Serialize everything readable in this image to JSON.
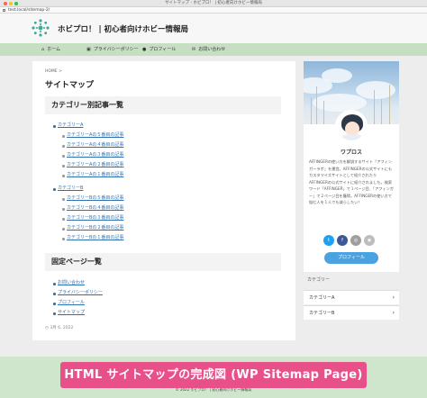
{
  "window": {
    "title": "サイトマップ - ホビプロ！ | 初心者向けホビー情報局",
    "url": "test.local/sitemap-2/"
  },
  "site": {
    "title": "ホビプロ！ | 初心者向けホビー情報局",
    "brand_color": "#c6dfc3"
  },
  "nav": {
    "items": [
      {
        "icon": "home-icon",
        "label": "ホーム"
      },
      {
        "icon": "lock-icon",
        "label": "プライバシーポリシー"
      },
      {
        "icon": "person-icon",
        "label": "プロフィール"
      },
      {
        "icon": "mail-icon",
        "label": "お問い合わせ"
      }
    ]
  },
  "main": {
    "breadcrumb": "HOME >",
    "page_title": "サイトマップ",
    "category_section": {
      "heading": "カテゴリー別記事一覧",
      "groups": [
        {
          "name": "カテゴリーA",
          "posts": [
            "カテゴリーAの５番目の記事",
            "カテゴリーAの４番目の記事",
            "カテゴリーAの３番目の記事",
            "カテゴリーAの２番目の記事",
            "カテゴリーAの１番目の記事"
          ]
        },
        {
          "name": "カテゴリーB",
          "posts": [
            "カテゴリーBの５番目の記事",
            "カテゴリーBの４番目の記事",
            "カテゴリーBの３番目の記事",
            "カテゴリーBの２番目の記事",
            "カテゴリーBの１番目の記事"
          ]
        }
      ]
    },
    "pages_section": {
      "heading": "固定ページ一覧",
      "pages": [
        "お問い合わせ",
        "プライバシーポリシー",
        "プロフィール",
        "サイトマップ"
      ]
    },
    "date": "3月 6, 2022"
  },
  "sidebar": {
    "profile": {
      "name": "ワプロス",
      "description": "AFFINGERの使い方を解説するサイト「アフィンガーラボ」を運営。AFFINGERの公式サイトにもカスタマイズサイトとして紹介されたりAFFINGERの公式サイトに紹介されました。検索ワード「AFFINGER」で１ページ目、「アフィンガー」で２ページ目を獲得。AFFINGERの使い方で悩む人を１人でも減らしたい！",
      "button": "プロフィール",
      "social": [
        "twitter-icon",
        "facebook-icon",
        "instagram-icon",
        "rss-icon"
      ]
    },
    "categories": {
      "heading": "カテゴリー",
      "items": [
        "カテゴリーA",
        "カテゴリーB"
      ]
    }
  },
  "banner": {
    "text": "HTML サイトマップの完成図 (WP Sitemap Page)",
    "color": "#e8508a"
  },
  "footer": {
    "copyright": "© 2022 ホビプロ！ | 初心者向けホビー情報局"
  }
}
